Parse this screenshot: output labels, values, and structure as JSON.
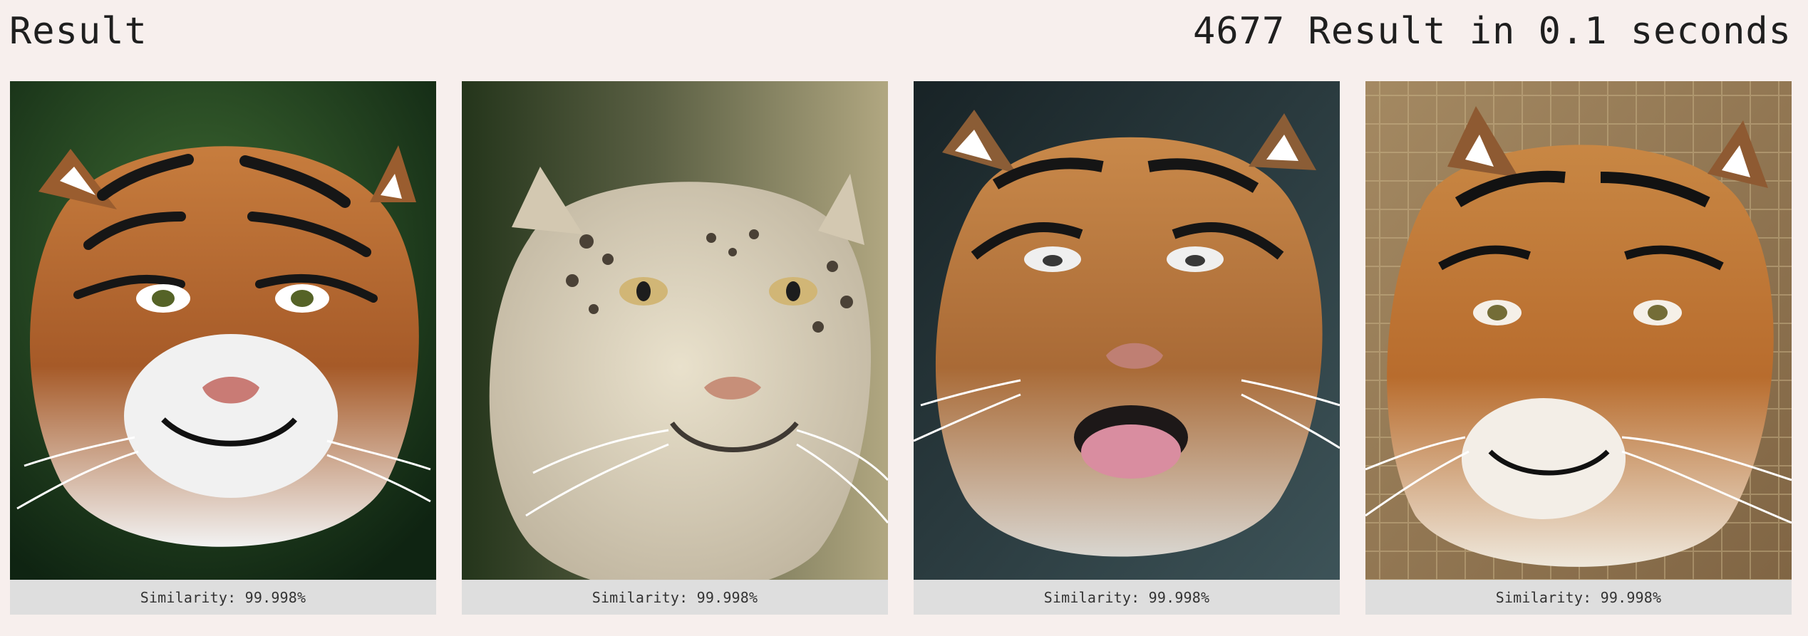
{
  "header": {
    "title": "Result",
    "summary": "4677 Result in 0.1 seconds"
  },
  "results": [
    {
      "image_label": "Tiger portrait with green background",
      "similarity_text": "Similarity: 99.998%"
    },
    {
      "image_label": "Snow leopard portrait",
      "similarity_text": "Similarity: 99.998%"
    },
    {
      "image_label": "Tiger licking lips",
      "similarity_text": "Similarity: 99.998%"
    },
    {
      "image_label": "Tiger portrait with fence background",
      "similarity_text": "Similarity: 99.998%"
    }
  ]
}
